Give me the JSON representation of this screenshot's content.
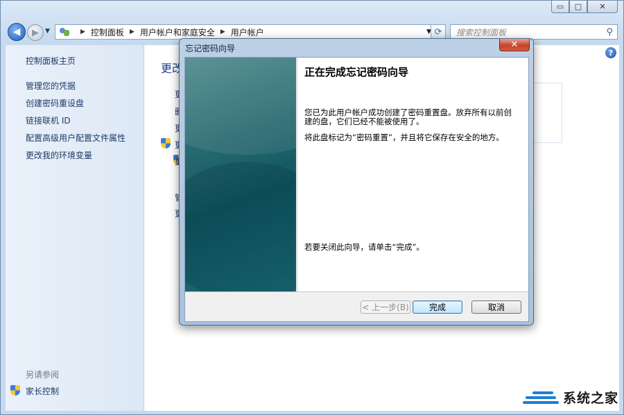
{
  "window": {
    "controls": {
      "minimize": "▭",
      "maximize": "□",
      "close": "✕"
    }
  },
  "address_bar": {
    "breadcrumbs": [
      "控制面板",
      "用户帐户和家庭安全",
      "用户帐户"
    ],
    "search_placeholder": "搜索控制面板"
  },
  "left_pane": {
    "links": [
      "控制面板主页",
      "管理您的凭据",
      "创建密码重设盘",
      "链接联机 ID",
      "配置高级用户配置文件属性",
      "更改我的环境变量"
    ],
    "see_also_title": "另请参阅",
    "see_also_items": [
      "家长控制"
    ]
  },
  "main_pane": {
    "heading": "更改",
    "items": [
      "更",
      "删",
      "更",
      "更",
      "更",
      "管",
      "更"
    ]
  },
  "dialog": {
    "title": "忘记密码向导",
    "close": "✕",
    "heading": "正在完成忘记密码向导",
    "para1": "您已为此用户帐户成功创建了密码重置盘。放弃所有以前创建的盘，它们已经不能被使用了。",
    "para2": "将此盘标记为“密码重置”，并且将它保存在安全的地方。",
    "para3": "若要关闭此向导，请单击“完成”。",
    "buttons": {
      "back": "< 上一步(B)",
      "finish": "完成",
      "cancel": "取消"
    }
  },
  "watermark": {
    "text": "系统之家"
  },
  "colors": {
    "accent": "#1e3f8a",
    "banner": "#1b6b75",
    "link": "#1f3a68"
  }
}
